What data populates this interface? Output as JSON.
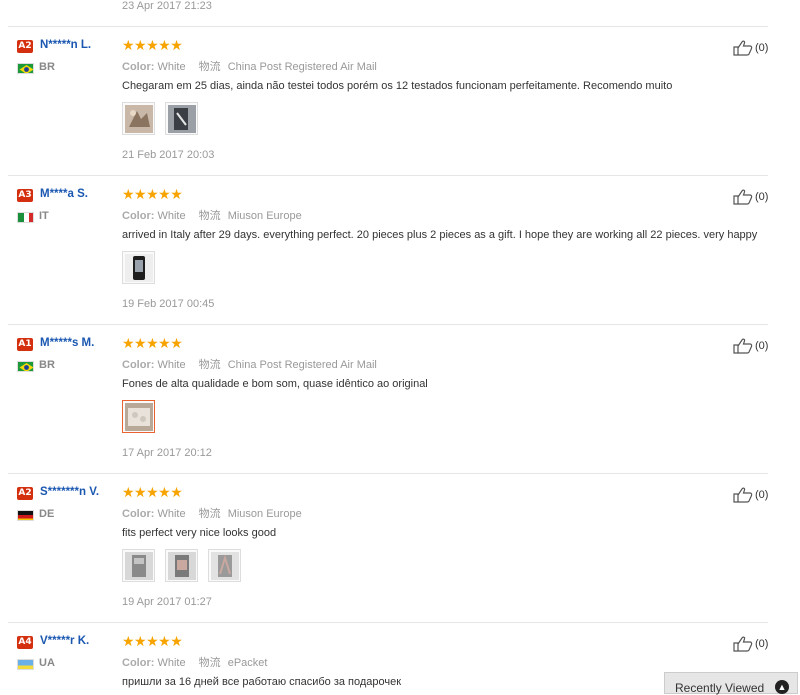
{
  "top_date": "23 Apr 2017 21:23",
  "labels": {
    "color": "Color:",
    "shipping": "物流"
  },
  "reviews": [
    {
      "level": "A2",
      "name": "N*****n L.",
      "country": "BR",
      "flag": "br",
      "stars": "★★★★★",
      "color": "White",
      "shipping": "China Post Registered Air Mail",
      "text": "Chegaram em 25 dias, ainda não testei todos porém os 12 testados funcionam perfeitamente. Recomendo muito",
      "photos": 2,
      "date": "21 Feb 2017 20:03",
      "helpful": "(0)"
    },
    {
      "level": "A3",
      "name": "M****a S.",
      "country": "IT",
      "flag": "it",
      "stars": "★★★★★",
      "color": "White",
      "shipping": "Miuson Europe",
      "text": "arrived in Italy after 29 days. everything perfect. 20 pieces plus 2 pieces as a gift. I hope they are working all 22 pieces. very happy",
      "photos": 1,
      "date": "19 Feb 2017 00:45",
      "helpful": "(0)"
    },
    {
      "level": "A1",
      "name": "M*****s M.",
      "country": "BR",
      "flag": "br",
      "stars": "★★★★★",
      "color": "White",
      "shipping": "China Post Registered Air Mail",
      "text": "Fones de alta qualidade e bom som, quase idêntico ao original",
      "photos": 1,
      "date": "17 Apr 2017 20:12",
      "helpful": "(0)"
    },
    {
      "level": "A2",
      "name": "S*******n V.",
      "country": "DE",
      "flag": "de",
      "stars": "★★★★★",
      "color": "White",
      "shipping": "Miuson Europe",
      "text": "fits perfect very nice looks good",
      "photos": 3,
      "date": "19 Apr 2017 01:27",
      "helpful": "(0)"
    },
    {
      "level": "A4",
      "name": "V*****r K.",
      "country": "UA",
      "flag": "ua",
      "stars": "★★★★★",
      "color": "White",
      "shipping": "ePacket",
      "text": "пришли за 16 дней все работаю спасибо за подарочек",
      "photos": 0,
      "date": "",
      "helpful": "(0)"
    }
  ],
  "recently_viewed": "Recently Viewed",
  "colors": {
    "accent_star": "#f7a300",
    "username": "#1a57b1",
    "level_badge": "#d4300f"
  }
}
